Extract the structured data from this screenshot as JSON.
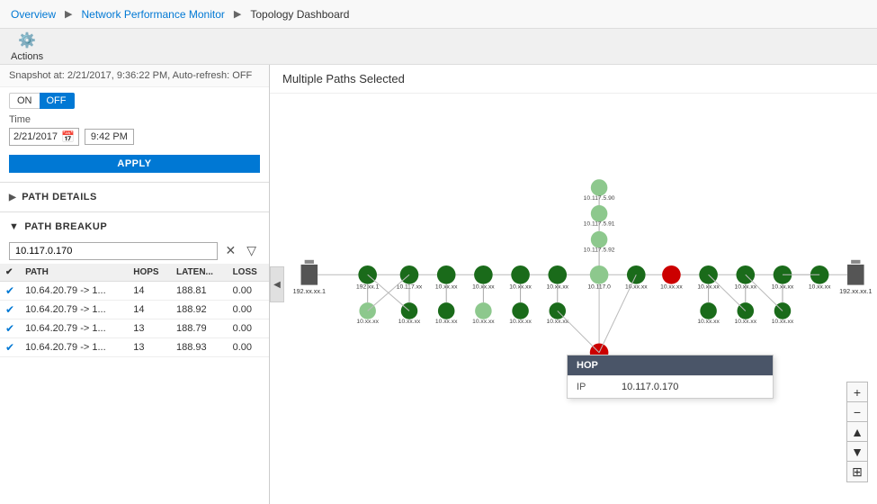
{
  "breadcrumb": {
    "items": [
      {
        "label": "Overview",
        "active": false
      },
      {
        "label": "Network Performance Monitor",
        "active": false
      },
      {
        "label": "Topology Dashboard",
        "active": true
      }
    ]
  },
  "actions_bar": {
    "actions_label": "Actions",
    "actions_icon": "⚙"
  },
  "left_panel": {
    "snapshot_text": "Snapshot at: 2/21/2017, 9:36:22 PM, Auto-refresh: OFF",
    "toggle_on": "ON",
    "toggle_off": "OFF",
    "time_label": "Time",
    "date_value": "2/21/2017",
    "time_value": "9:42 PM",
    "apply_label": "APPLY",
    "path_details_label": "PATH DETAILS",
    "path_breakup_label": "PATH BREAKUP",
    "search_placeholder": "10.117.0.170",
    "table": {
      "headers": [
        "",
        "PATH",
        "HOPS",
        "LATEN...",
        "LOSS"
      ],
      "rows": [
        {
          "checked": true,
          "path": "10.64.20.79 -> 1...",
          "hops": "14",
          "latency": "188.81",
          "loss": "0.00"
        },
        {
          "checked": true,
          "path": "10.64.20.79 -> 1...",
          "hops": "14",
          "latency": "188.92",
          "loss": "0.00"
        },
        {
          "checked": true,
          "path": "10.64.20.79 -> 1...",
          "hops": "13",
          "latency": "188.79",
          "loss": "0.00"
        },
        {
          "checked": true,
          "path": "10.64.20.79 -> 1...",
          "hops": "13",
          "latency": "188.93",
          "loss": "0.00"
        }
      ]
    }
  },
  "right_panel": {
    "title": "Multiple Paths Selected",
    "hop_tooltip": {
      "header": "HOP",
      "label": "IP",
      "value": "10.117.0.170"
    }
  },
  "zoom": {
    "plus": "+",
    "minus": "−",
    "up_arrow": "▲",
    "down_arrow": "▼",
    "grid": "⊞"
  }
}
